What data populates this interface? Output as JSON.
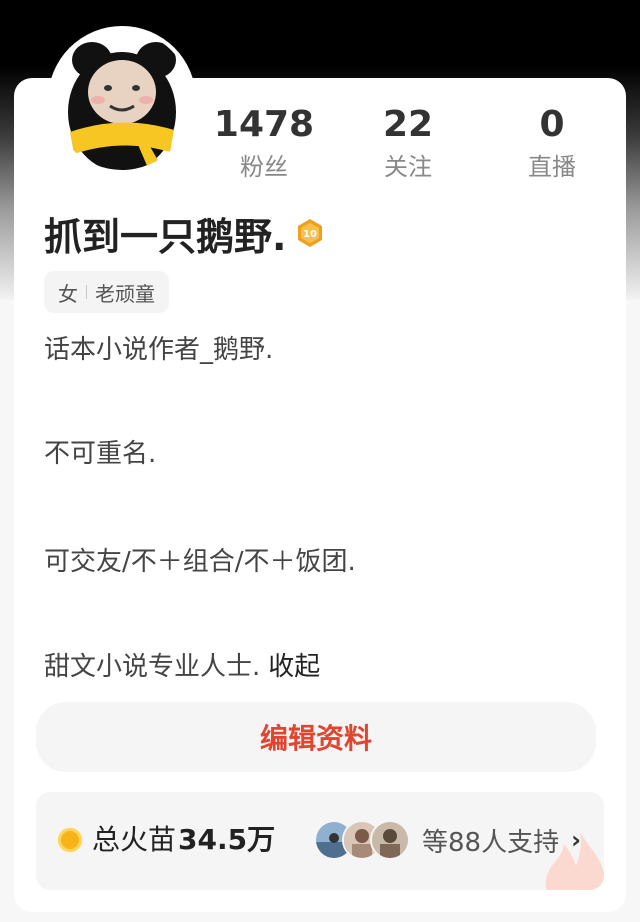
{
  "profile": {
    "username": "抓到一只鹅野.",
    "level": "10",
    "stats": [
      {
        "value": "1478",
        "label": "粉丝"
      },
      {
        "value": "22",
        "label": "关注"
      },
      {
        "value": "0",
        "label": "直播"
      }
    ],
    "tags": [
      "女",
      "老顽童"
    ],
    "bio": [
      "话本小说作者_鹅野.",
      "不可重名.",
      "可交友/不＋组合/不＋饭团.",
      "甜文小说专业人士."
    ],
    "collapse_label": "收起"
  },
  "actions": {
    "edit_label": "编辑资料"
  },
  "fire": {
    "label": "总火苗",
    "value": "34.5万",
    "support_text": "等88人支持"
  },
  "icons": {
    "coin": "coin-icon",
    "chevron": "chevron-right-icon",
    "level": "level-badge-icon",
    "flame": "flame-icon"
  },
  "colors": {
    "accent": "#e2452f",
    "badge": "#f0a020"
  }
}
